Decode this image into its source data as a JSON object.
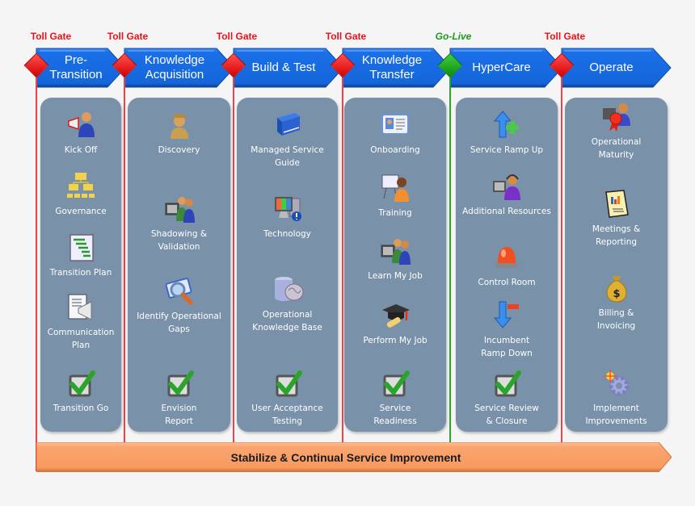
{
  "gates": [
    {
      "label": "Toll Gate",
      "type": "toll",
      "color": "#e8121b"
    },
    {
      "label": "Toll Gate",
      "type": "toll",
      "color": "#e8121b"
    },
    {
      "label": "Toll Gate",
      "type": "toll",
      "color": "#e8121b"
    },
    {
      "label": "Toll Gate",
      "type": "toll",
      "color": "#e8121b"
    },
    {
      "label": "Go-Live",
      "type": "golive",
      "color": "#1d9a1d"
    },
    {
      "label": "Toll Gate",
      "type": "toll",
      "color": "#e8121b"
    }
  ],
  "phases": [
    {
      "title": "Pre-\nTransition",
      "items": [
        {
          "label": "Kick Off",
          "icon": "megaphone-person-icon"
        },
        {
          "label": "Governance",
          "icon": "org-chart-icon"
        },
        {
          "label": "Transition Plan",
          "icon": "gantt-chart-icon"
        },
        {
          "label": "Communication\nPlan",
          "icon": "document-megaphone-icon"
        },
        {
          "label": "Transition Go",
          "icon": "checkbox-checked-icon"
        }
      ]
    },
    {
      "title": "Knowledge\nAcquisition",
      "items": [
        {
          "label": "Discovery",
          "icon": "detective-icon"
        },
        {
          "label": "Shadowing &\nValidation",
          "icon": "users-computer-icon"
        },
        {
          "label": "Identify Operational\nGaps",
          "icon": "magnifier-document-icon"
        },
        {
          "label": "Envision\nReport",
          "icon": "checkbox-checked-icon"
        }
      ]
    },
    {
      "title": "Build & Test",
      "items": [
        {
          "label": "Managed Service\nGuide",
          "icon": "book-icon"
        },
        {
          "label": "Technology",
          "icon": "computer-alert-icon"
        },
        {
          "label": "Operational\nKnowledge Base",
          "icon": "database-brain-icon"
        },
        {
          "label": "User Acceptance\nTesting",
          "icon": "checkbox-checked-icon"
        }
      ]
    },
    {
      "title": "Knowledge\nTransfer",
      "items": [
        {
          "label": "Onboarding",
          "icon": "id-card-icon"
        },
        {
          "label": "Training",
          "icon": "trainer-icon"
        },
        {
          "label": "Learn My Job",
          "icon": "users-computer-icon"
        },
        {
          "label": "Perform My Job",
          "icon": "graduation-cap-icon"
        },
        {
          "label": "Service\nReadiness",
          "icon": "checkbox-checked-icon"
        }
      ]
    },
    {
      "title": "HyperCare",
      "items": [
        {
          "label": "Service Ramp Up",
          "icon": "arrow-up-plus-icon"
        },
        {
          "label": "Additional Resources",
          "icon": "support-agent-icon"
        },
        {
          "label": "Control Room",
          "icon": "siren-light-icon"
        },
        {
          "label": "Incumbent\nRamp Down",
          "icon": "arrow-down-minus-icon"
        },
        {
          "label": "Service Review\n& Closure",
          "icon": "checkbox-checked-icon"
        }
      ]
    },
    {
      "title": "Operate",
      "items": [
        {
          "label": "Operational\nMaturity",
          "icon": "award-person-icon"
        },
        {
          "label": "Meetings &\nReporting",
          "icon": "report-document-icon"
        },
        {
          "label": "Billing &\nInvoicing",
          "icon": "money-bag-icon"
        },
        {
          "label": "Implement\nImprovements",
          "icon": "gear-spark-icon"
        }
      ]
    }
  ],
  "footer": {
    "label": "Stabilize & Continual Service Improvement"
  },
  "colors": {
    "chevron": "#1a6fe8",
    "panel": "#7a91aa",
    "toll_gate": "#e8121b",
    "go_live": "#1d9a1d",
    "footer_arrow": "#fba570"
  }
}
